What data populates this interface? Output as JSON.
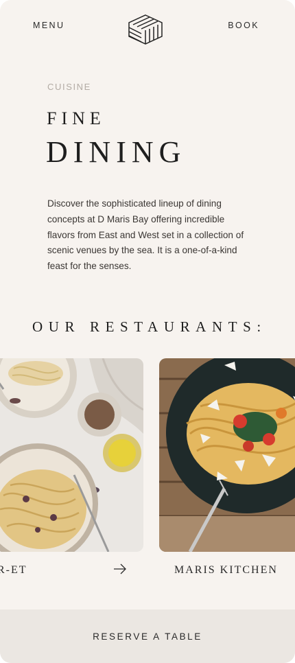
{
  "header": {
    "menu_label": "MENU",
    "book_label": "BOOK",
    "logo_icon": "cube-logo-icon"
  },
  "intro": {
    "eyebrow": "CUISINE",
    "title_line1": "FINE",
    "title_line2": "DINING",
    "description": "Discover the sophisticated lineup of dining concepts at D Maris Bay offering incredible flavors from East and West set in a collection of scenic venues by the sea. It is a one-of-a-kind feast for the senses."
  },
  "restaurants": {
    "heading": "OUR RESTAURANTS:",
    "cards": [
      {
        "label": "R-ET",
        "image_icon": "pasta-plates-photo"
      },
      {
        "label": "MARIS KITCHEN",
        "image_icon": "spaghetti-dark-plate-photo"
      }
    ],
    "next_icon": "arrow-right-icon"
  },
  "footer": {
    "reserve_label": "RESERVE A TABLE"
  },
  "colors": {
    "background": "#f7f3ef",
    "footer_bg": "#ebe7e2",
    "text": "#1e1e1e",
    "muted": "#b2aba4"
  }
}
